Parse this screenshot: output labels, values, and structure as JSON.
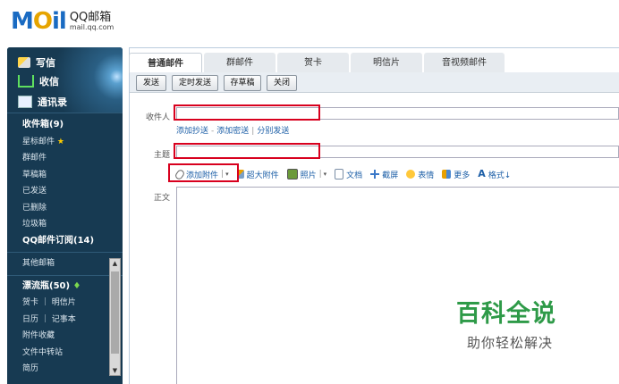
{
  "logo": {
    "main_1": "M",
    "main_2": "O",
    "main_3": "il",
    "brand": "QQ邮箱",
    "domain": "mail.qq.com"
  },
  "sidebar": {
    "write": "写信",
    "inbox": "收信",
    "contacts": "通讯录",
    "folders": [
      {
        "label": "收件箱(9)",
        "bold": true
      },
      {
        "label": "星标邮件",
        "badge": "★"
      },
      {
        "label": "群邮件"
      },
      {
        "label": "草稿箱"
      },
      {
        "label": "已发送"
      },
      {
        "label": "已删除"
      },
      {
        "label": "垃圾箱"
      },
      {
        "label": "QQ邮件订阅(14)",
        "bold": true
      }
    ],
    "other_mailbox": "其他邮箱",
    "tools": [
      {
        "label": "漂流瓶(50)",
        "bold": true,
        "badge": "♦"
      },
      {
        "label": "贺卡 ｜ 明信片"
      },
      {
        "label": "日历 ｜ 记事本"
      },
      {
        "label": "附件收藏"
      },
      {
        "label": "文件中转站"
      },
      {
        "label": "简历"
      }
    ],
    "scroll_up": "▲",
    "scroll_down": "▼"
  },
  "tabs": [
    "普通邮件",
    "群邮件",
    "贺卡",
    "明信片",
    "音视频邮件"
  ],
  "toolbar": {
    "send": "发送",
    "timed_send": "定时发送",
    "save_draft": "存草稿",
    "close": "关闭"
  },
  "compose": {
    "to_label": "收件人",
    "add_cc": "添加抄送",
    "dash": "-",
    "add_bcc": "添加密送",
    "pipe": "|",
    "separate_send": "分别发送",
    "subject_label": "主题",
    "body_label": "正文"
  },
  "editbar": {
    "attach": "添加附件",
    "large_attach": "超大附件",
    "photo": "照片",
    "doc": "文档",
    "screenshot": "截屏",
    "emoji": "表情",
    "more": "更多",
    "format": "格式↓",
    "caret": "▾",
    "bar": "|"
  },
  "watermark": {
    "title": "百科全说",
    "subtitle": "助你轻松解决"
  },
  "colors": {
    "sidebar_bg": "#173a52",
    "highlight_red": "#d8001e",
    "link_blue": "#1d5fa7",
    "watermark_green": "#2e9a48"
  }
}
